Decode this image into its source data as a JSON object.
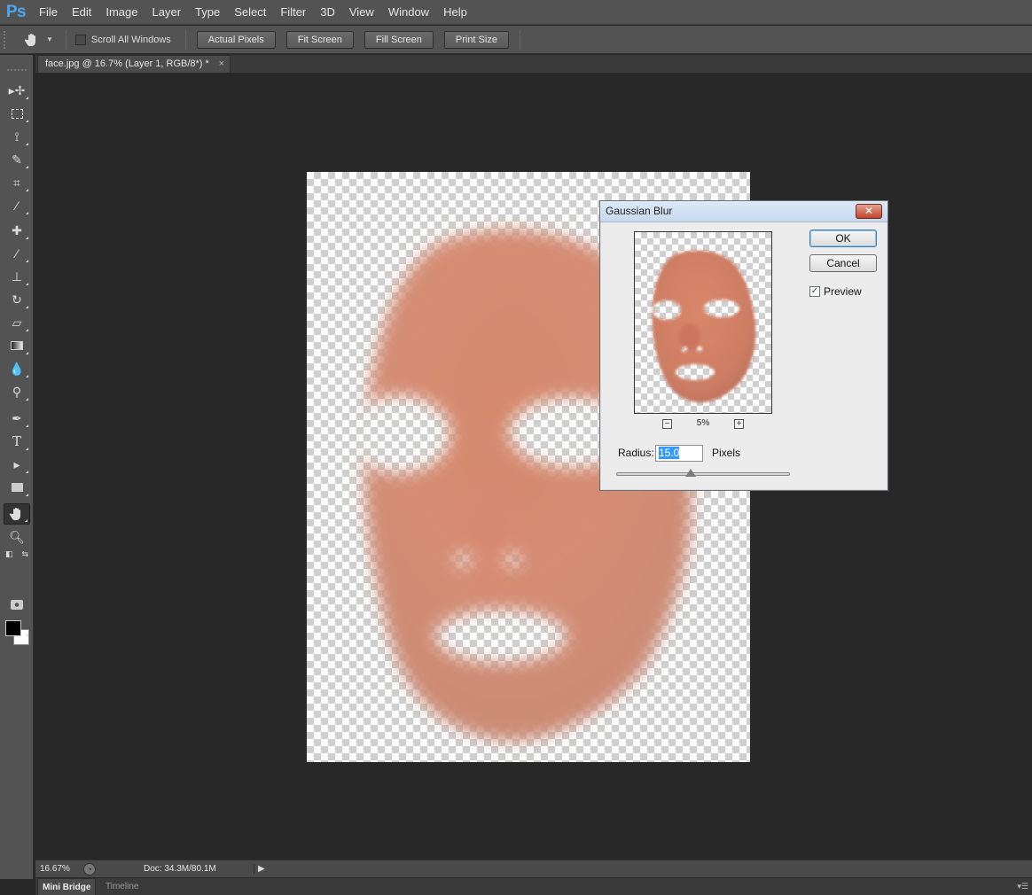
{
  "app": {
    "logo": "Ps"
  },
  "menu": [
    "File",
    "Edit",
    "Image",
    "Layer",
    "Type",
    "Select",
    "Filter",
    "3D",
    "View",
    "Window",
    "Help"
  ],
  "options": {
    "scroll_all_windows": "Scroll All Windows",
    "actual_pixels": "Actual Pixels",
    "fit_screen": "Fit Screen",
    "fill_screen": "Fill Screen",
    "print_size": "Print Size"
  },
  "document_tab": {
    "title": "face.jpg @ 16.7% (Layer 1, RGB/8*) *",
    "close": "×"
  },
  "status": {
    "zoom": "16.67%",
    "doc": "Doc: 34.3M/80.1M"
  },
  "bottom_tabs": {
    "mini_bridge": "Mini Bridge",
    "timeline": "Timeline"
  },
  "dialog": {
    "title": "Gaussian Blur",
    "ok": "OK",
    "cancel": "Cancel",
    "preview_label": "Preview",
    "preview_checked": true,
    "zoom_pct": "5%",
    "radius_label": "Radius:",
    "radius_value": "15.0",
    "units": "Pixels"
  },
  "colors": {
    "accent": "#4aa8f0",
    "skin": "#d98b70"
  },
  "icons": [
    "hand-icon",
    "move-icon",
    "marquee-icon",
    "lasso-icon",
    "quick-select-icon",
    "crop-icon",
    "eyedropper-icon",
    "healing-icon",
    "brush-icon",
    "stamp-icon",
    "history-brush-icon",
    "eraser-icon",
    "gradient-icon",
    "blur-icon",
    "dodge-icon",
    "pen-icon",
    "type-icon",
    "path-select-icon",
    "rectangle-icon",
    "zoom-icon",
    "quick-mask-icon",
    "screen-mode-icon"
  ]
}
